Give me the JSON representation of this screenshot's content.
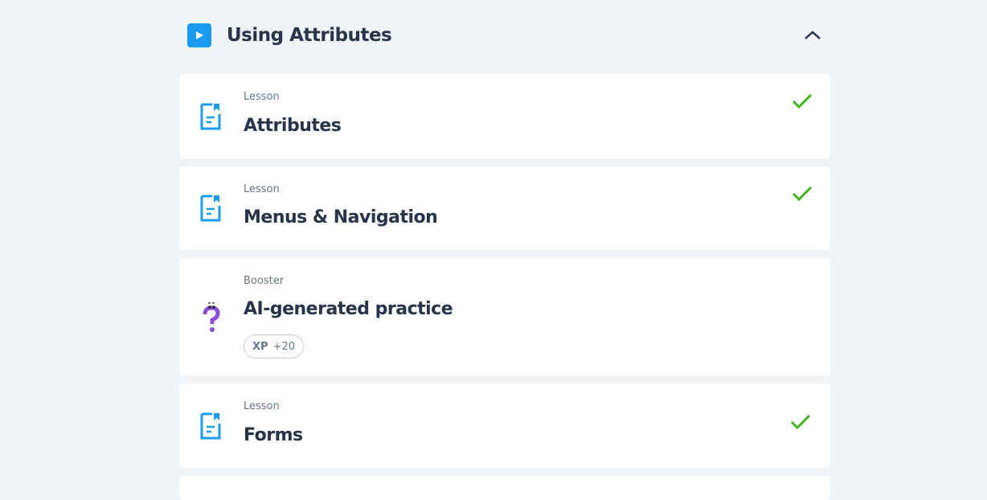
{
  "section": {
    "title": "Using Attributes",
    "expanded": true
  },
  "items": [
    {
      "type": "Lesson",
      "title": "Attributes",
      "completed": true
    },
    {
      "type": "Lesson",
      "title": "Menus & Navigation",
      "completed": true
    },
    {
      "type": "Booster",
      "title": "AI-generated practice",
      "xp_label": "XP",
      "xp_value": "+20",
      "completed": false
    },
    {
      "type": "Lesson",
      "title": "Forms",
      "completed": true
    }
  ],
  "colors": {
    "accent": "#1a9cf3",
    "check": "#3fb618",
    "booster": "#8a4fd8"
  }
}
